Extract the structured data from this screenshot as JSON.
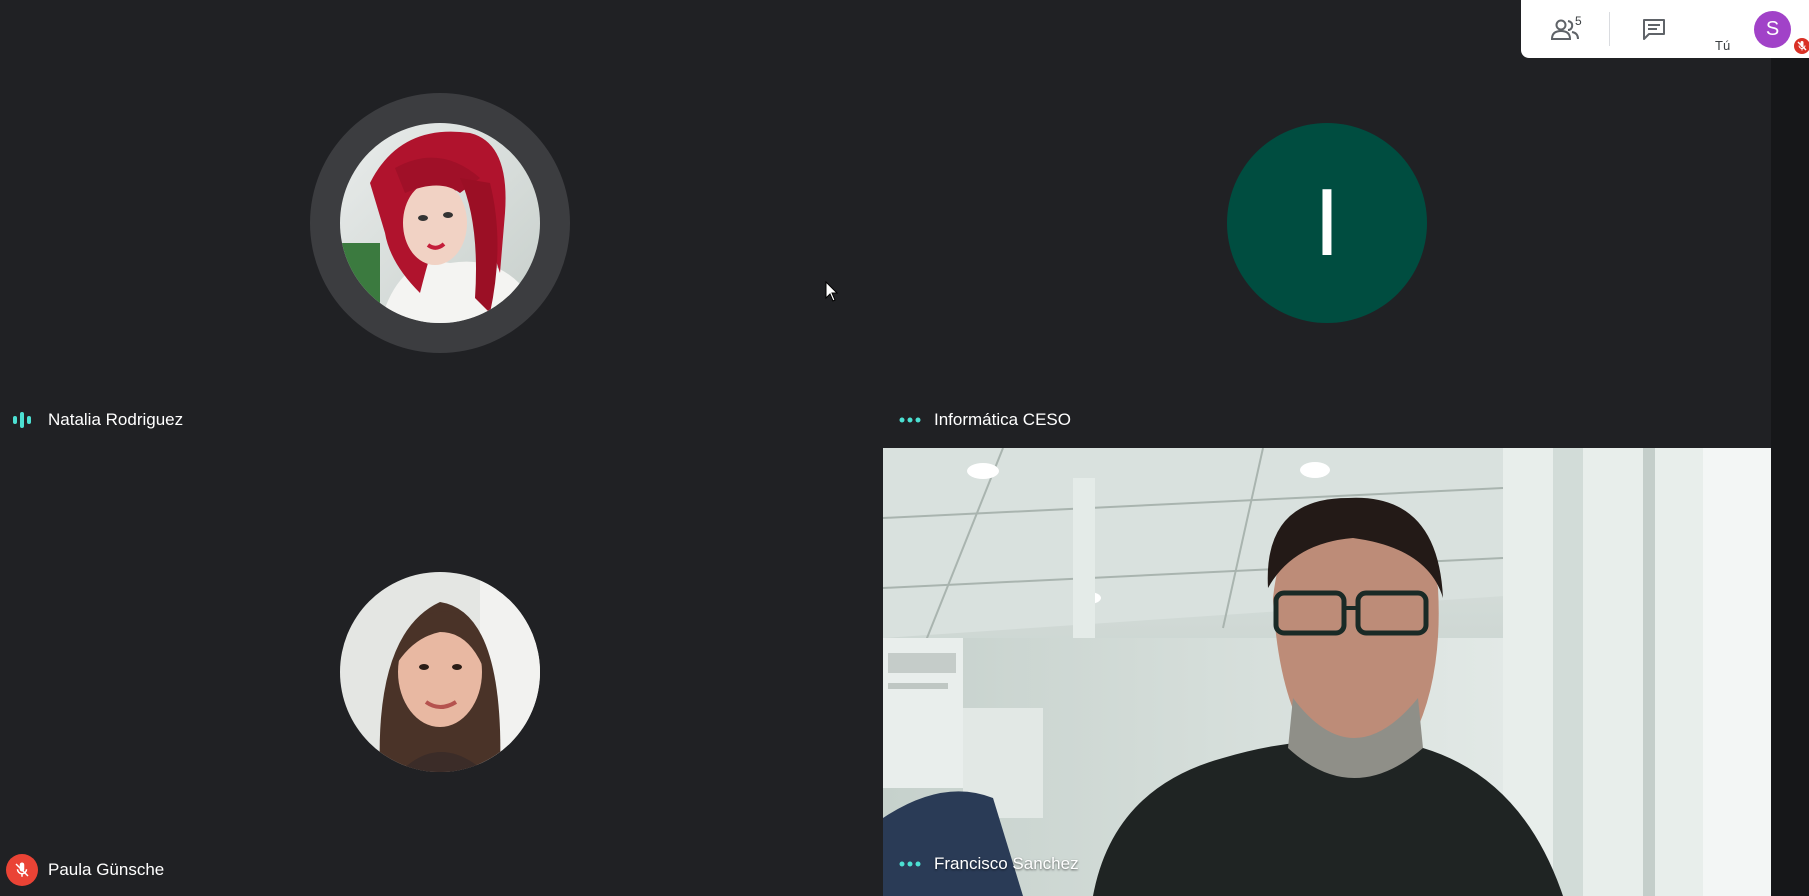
{
  "participants": {
    "natalia": {
      "name": "Natalia Rodriguez",
      "status": "speaking"
    },
    "informatica": {
      "name": "Informática CESO",
      "initial": "I",
      "avatar_color": "#004d40"
    },
    "paula": {
      "name": "Paula Günsche",
      "status": "muted"
    },
    "francisco": {
      "name": "Francisco Sanchez",
      "status": "video-on"
    }
  },
  "top_panel": {
    "people_count": "5",
    "people_icon": "people-icon",
    "chat_icon": "chat-icon",
    "self_label": "Tú",
    "self_initial": "S",
    "self_avatar_color": "#a142c8",
    "self_status_icon": "mic-off-icon"
  },
  "colors": {
    "background": "#202124",
    "accent": "#4ce0d2",
    "muted": "#ea4335"
  }
}
